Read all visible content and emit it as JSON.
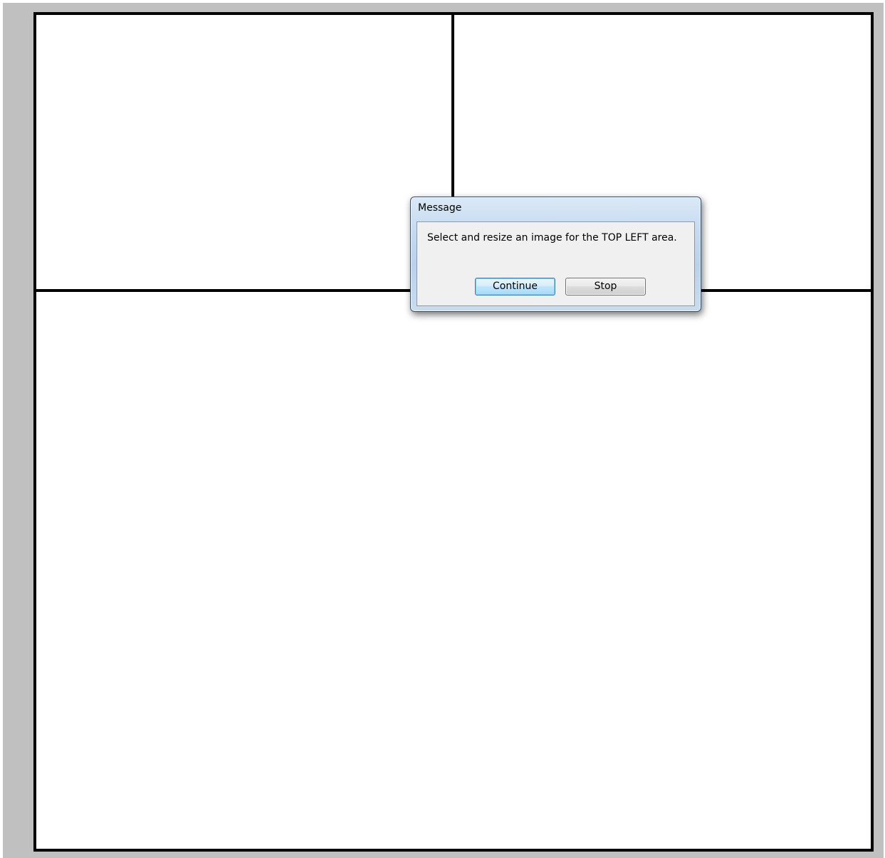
{
  "dialog": {
    "title": "Message",
    "message": "Select and resize an image for the TOP LEFT area.",
    "continue_label": "Continue",
    "stop_label": "Stop"
  },
  "colors": {
    "frame_background": "#c0c0c0",
    "canvas_background": "#ffffff",
    "divider": "#000000",
    "default_button_accent": "#3c7fb1"
  }
}
